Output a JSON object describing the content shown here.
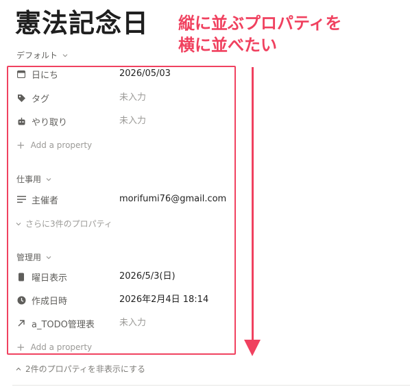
{
  "title": "憲法記念日",
  "annotation": {
    "line1": "縦に並ぶプロパティを",
    "line2": "横に並べたい"
  },
  "groups": [
    {
      "label": "デフォルト",
      "properties": [
        {
          "name": "日にち",
          "value": "2026/05/03",
          "empty": false,
          "icon": "calendar-icon"
        },
        {
          "name": "タグ",
          "value": "未入力",
          "empty": true,
          "icon": "tag-icon"
        },
        {
          "name": "やり取り",
          "value": "未入力",
          "empty": true,
          "icon": "robot-icon"
        }
      ],
      "add_label": "Add a property"
    },
    {
      "label": "仕事用",
      "properties": [
        {
          "name": "主催者",
          "value": "morifumi76@gmail.com",
          "empty": false,
          "icon": "text-lines-icon"
        }
      ],
      "more_label": "さらに3件のプロパティ"
    },
    {
      "label": "管理用",
      "properties": [
        {
          "name": "曜日表示",
          "value": "2026/5/3(日)",
          "empty": false,
          "icon": "phone-icon"
        },
        {
          "name": "作成日時",
          "value": "2026年2月4日 18:14",
          "empty": false,
          "icon": "clock-icon"
        },
        {
          "name": "a_TODO管理表",
          "value": "未入力",
          "empty": true,
          "icon": "relation-arrow-icon"
        }
      ],
      "add_label": "Add a property"
    }
  ],
  "hide_label": "2件のプロパティを非表示にする",
  "accent_color": "#f0415f"
}
